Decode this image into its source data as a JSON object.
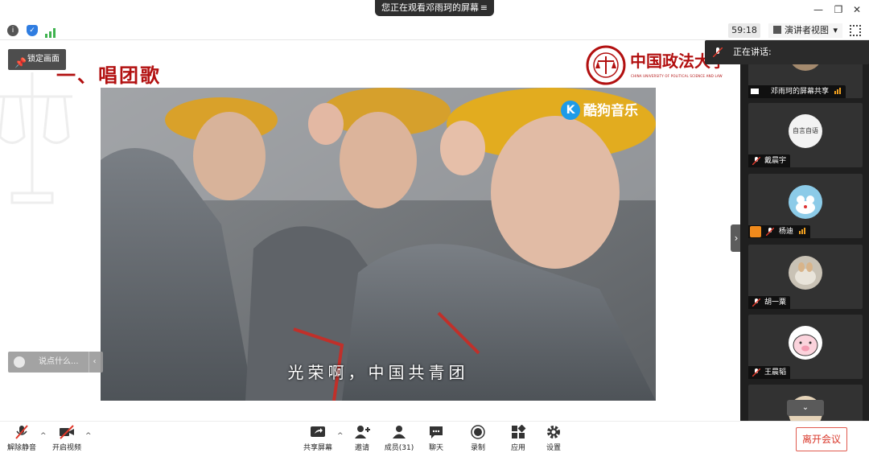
{
  "titlebar": {
    "viewing_text": "您正在观看邓雨珂的屏幕",
    "menu_icon": "≡",
    "minimize": "—",
    "restore": "❐",
    "close": "✕"
  },
  "toolbar": {
    "timer": "59:18",
    "view_mode": "演讲者视图",
    "view_caret": "▾",
    "icons": [
      "info-icon",
      "shield-icon",
      "signal-icon",
      "fullscreen-icon"
    ],
    "colors": {
      "info": "#555555",
      "shield": "#2f7de1",
      "signal": "#3fb34f"
    }
  },
  "slide": {
    "title": "一、唱团歌",
    "lock_label": "锁定画面",
    "university_name": "中国政法大学",
    "university_subname": "CHINA UNIVERSITY OF POLITICAL SCIENCE AND LAW",
    "video": {
      "brand": "酷狗音乐",
      "brand_letter": "K",
      "subtitle": "光荣啊，中国共青团"
    },
    "chat_placeholder": "说点什么...",
    "chat_arrow": "‹",
    "collapse_arrow": "›",
    "accent_color": "#b21010"
  },
  "panel": {
    "speaking_label": "正在讲话:",
    "participants": [
      {
        "name": "邓雨珂的屏幕共享",
        "screen_share": true,
        "audio_bars": true
      },
      {
        "name": "戴晨宇",
        "avatar_text": "自言自语"
      },
      {
        "name": "杨迪",
        "audio_bars": true,
        "host_badge": true
      },
      {
        "name": "胡一粟"
      },
      {
        "name": "王晨韬"
      }
    ],
    "scroll_down": "⌄"
  },
  "bottombar": {
    "mute_label": "解除静音",
    "video_label": "开启视频",
    "share_label": "共享屏幕",
    "invite_label": "邀请",
    "members_label": "成员(31)",
    "chat_label": "聊天",
    "record_label": "录制",
    "apps_label": "应用",
    "settings_label": "设置",
    "leave_label": "离开会议",
    "caret": "^",
    "leave_color": "#d9372a"
  }
}
